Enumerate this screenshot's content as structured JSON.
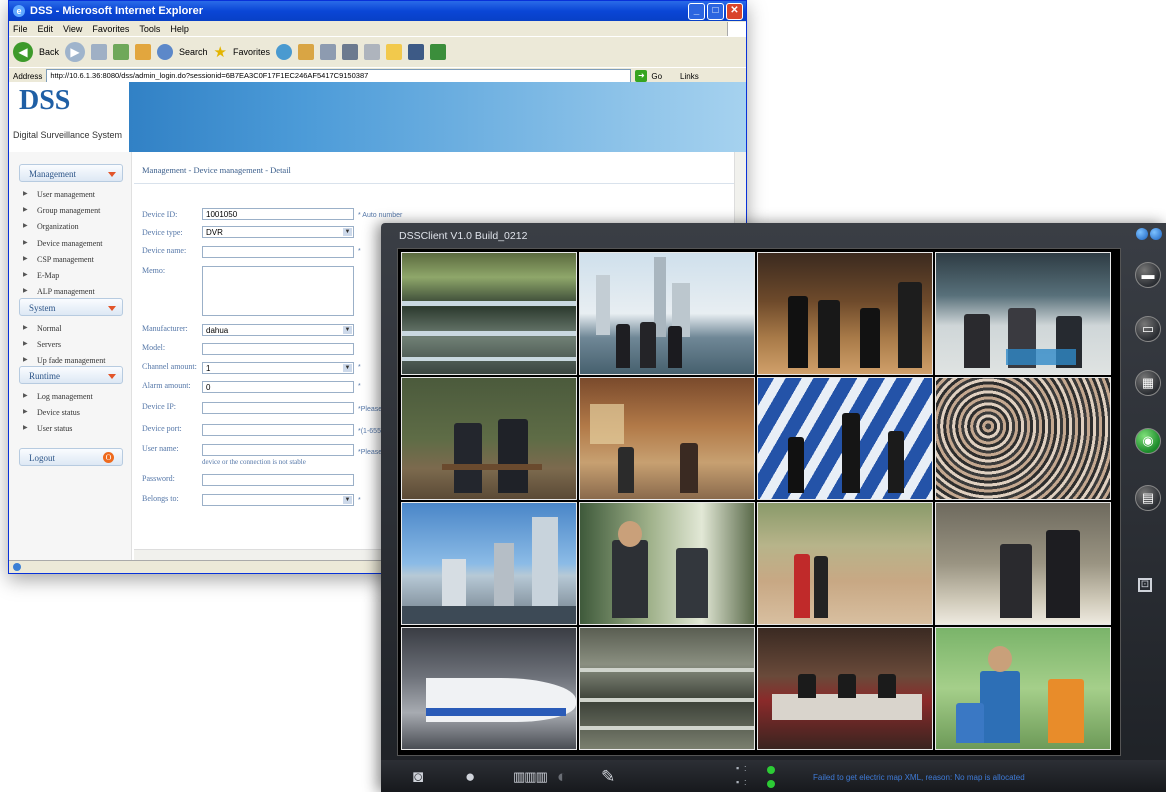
{
  "ie": {
    "title": "DSS - Microsoft Internet Explorer",
    "menu": [
      "File",
      "Edit",
      "View",
      "Favorites",
      "Tools",
      "Help"
    ],
    "toolbar": {
      "back": "Back",
      "search": "Search",
      "favorites": "Favorites"
    },
    "address_label": "Address",
    "address_url": "http://10.6.1.36:8080/dss/admin_login.do?sessionid=6B7EA3C0F17F1EC246AF5417C9150387",
    "go_label": "Go",
    "links_label": "Links"
  },
  "app": {
    "brand": "DSS",
    "brand_sub": "Digital Surveillance System",
    "sections": [
      {
        "label": "Management",
        "items": [
          "User management",
          "Group management",
          "Organization",
          "Device management",
          "CSP management",
          "E-Map",
          "ALP management"
        ]
      },
      {
        "label": "System",
        "items": [
          "Normal",
          "Servers",
          "Up fade management"
        ]
      },
      {
        "label": "Runtime",
        "items": [
          "Log management",
          "Device status",
          "User status"
        ]
      }
    ],
    "logout": "Logout",
    "breadcrumb": "Management - Device management - Detail",
    "form": {
      "device_id": {
        "label": "Device ID:",
        "value": "1001050",
        "hint": "* Auto number"
      },
      "device_type": {
        "label": "Device type:",
        "value": "DVR"
      },
      "device_name": {
        "label": "Device name:",
        "value": "",
        "hint": "*"
      },
      "memo": {
        "label": "Memo:"
      },
      "manufacturer": {
        "label": "Manufacturer:",
        "value": "dahua"
      },
      "model": {
        "label": "Model:",
        "value": ""
      },
      "channel_amount": {
        "label": "Channel amount:",
        "value": "1",
        "hint": "*"
      },
      "alarm_amount": {
        "label": "Alarm amount:",
        "value": "0",
        "hint": "*"
      },
      "device_ip": {
        "label": "Device IP:",
        "value": "",
        "hint": "*Please"
      },
      "device_port": {
        "label": "Device port:",
        "value": "",
        "hint": "*(1-655"
      },
      "user_name": {
        "label": "User name:",
        "value": "",
        "hint": "*Please"
      },
      "conn_note": "device or the connection is not stable",
      "password": {
        "label": "Password:",
        "value": ""
      },
      "belongs_to": {
        "label": "Belongs to:",
        "value": "",
        "hint": "*"
      }
    }
  },
  "client": {
    "title": "DSSClient V1.0 Build_0212",
    "status_message": "Failed to get electric map XML, reason: No map is allocated",
    "status_rows": [
      ":",
      ":"
    ],
    "right_icons": [
      "device-icon",
      "monitor-icon",
      "layout-icon",
      "globe-icon",
      "emap-icon",
      "fullscreen-icon"
    ],
    "bottom_icons": [
      "camera-icon",
      "webcam-icon",
      "film-icon",
      "record-icon",
      "wrench-icon"
    ],
    "status_color": "#2ccb35",
    "message_color": "#3f7bd6"
  }
}
